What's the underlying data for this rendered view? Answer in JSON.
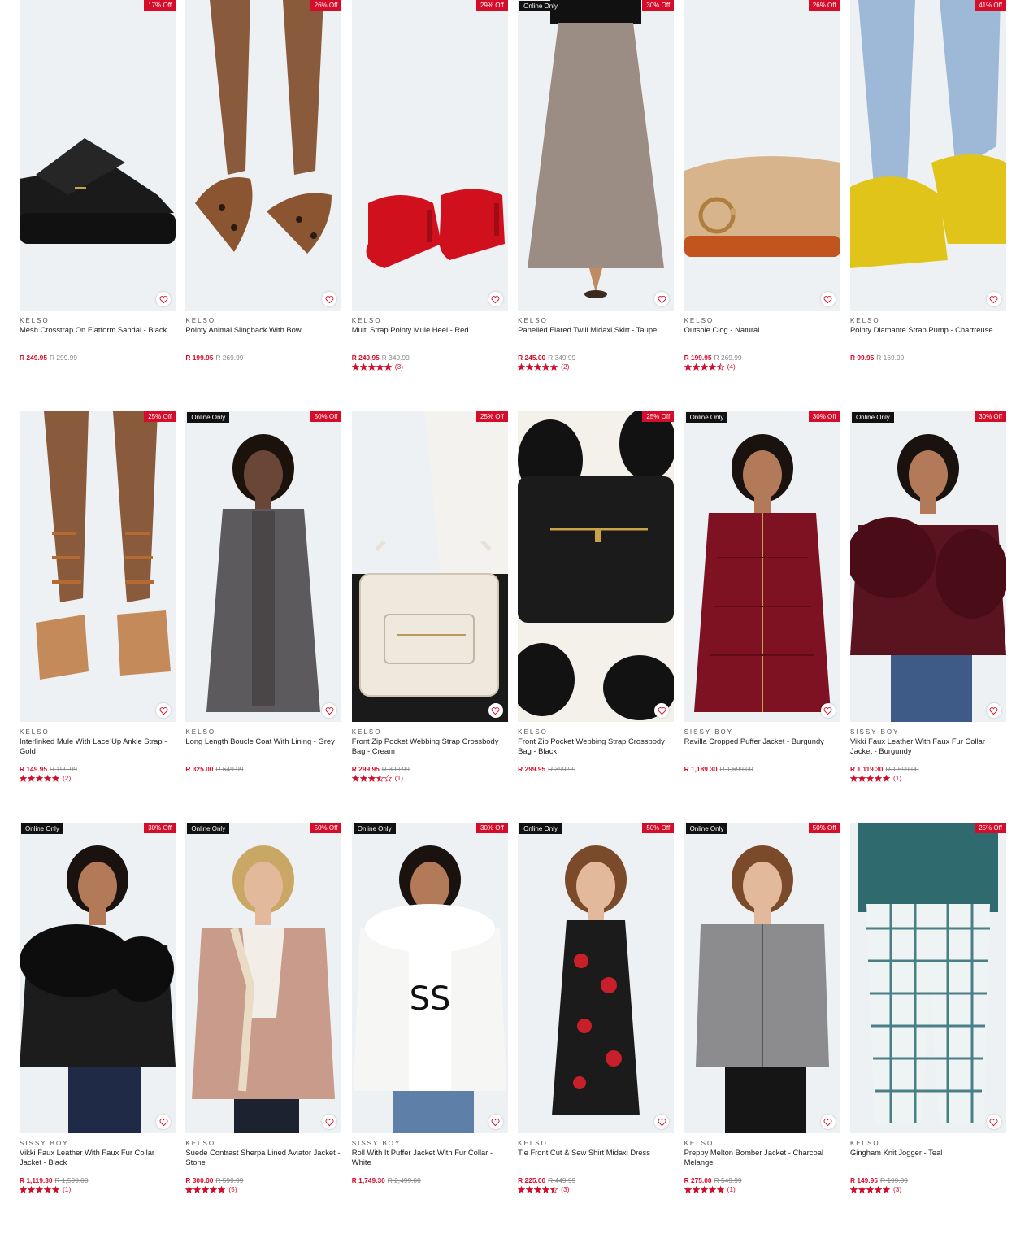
{
  "colors": {
    "sale_red": "#d50d2a",
    "badge_black": "#111111",
    "image_bg": "#edf1f3"
  },
  "products": [
    {
      "brand": "KELSO",
      "name": "Mesh Crosstrap On Flatform Sandal - Black",
      "price": "R 249.95",
      "was": "R 299.99",
      "discount": "17% Off",
      "online": "",
      "rating": null,
      "reviews": "",
      "scene": "sandal-black"
    },
    {
      "brand": "KELSO",
      "name": "Pointy Animal Slingback With Bow",
      "price": "R 199.95",
      "was": "R 269.99",
      "discount": "26% Off",
      "online": "",
      "rating": null,
      "reviews": "",
      "scene": "legs-leopard"
    },
    {
      "brand": "KELSO",
      "name": "Multi Strap Pointy Mule Heel - Red",
      "price": "R 249.95",
      "was": "R 349.99",
      "discount": "29% Off",
      "online": "",
      "rating": 5,
      "reviews": "(3)",
      "scene": "heels-red"
    },
    {
      "brand": "KELSO",
      "name": "Panelled Flared Twill Midaxi Skirt - Taupe",
      "price": "R 245.00",
      "was": "R 349.99",
      "discount": "30% Off",
      "online": "Online Only",
      "rating": 5,
      "reviews": "(2)",
      "scene": "skirt-taupe"
    },
    {
      "brand": "KELSO",
      "name": "Outsole Clog - Natural",
      "price": "R 199.95",
      "was": "R 269.99",
      "discount": "26% Off",
      "online": "",
      "rating": 4.5,
      "reviews": "(4)",
      "scene": "clog"
    },
    {
      "brand": "KELSO",
      "name": "Pointy Diamante Strap Pump - Chartreuse",
      "price": "R 99.95",
      "was": "R 169.99",
      "discount": "41% Off",
      "online": "",
      "rating": null,
      "reviews": "",
      "scene": "pump-yellow"
    },
    {
      "brand": "KELSO",
      "name": "Interlinked Mule With Lace Up Ankle Strap - Gold",
      "price": "R 149.95",
      "was": "R 199.99",
      "discount": "25% Off",
      "online": "",
      "rating": 5,
      "reviews": "(2)",
      "scene": "sandal-gold"
    },
    {
      "brand": "KELSO",
      "name": "Long Length Boucle Coat With Lining - Grey",
      "price": "R 325.00",
      "was": "R 649.99",
      "discount": "50% Off",
      "online": "Online Only",
      "rating": null,
      "reviews": "",
      "scene": "coat-grey"
    },
    {
      "brand": "KELSO",
      "name": "Front Zip Pocket Webbing Strap Crossbody Bag - Cream",
      "price": "R 299.95",
      "was": "R 399.99",
      "discount": "25% Off",
      "online": "",
      "rating": 3.5,
      "reviews": "(1)",
      "scene": "bag-cream"
    },
    {
      "brand": "KELSO",
      "name": "Front Zip Pocket Webbing Strap Crossbody Bag - Black",
      "price": "R 299.95",
      "was": "R 399.99",
      "discount": "25% Off",
      "online": "",
      "rating": null,
      "reviews": "",
      "scene": "bag-black"
    },
    {
      "brand": "SISSY BOY",
      "name": "Ravilla Cropped Puffer Jacket - Burgundy",
      "price": "R 1,189.30",
      "was": "R 1,699.00",
      "discount": "30% Off",
      "online": "Online Only",
      "rating": null,
      "reviews": "",
      "scene": "puffer-burgundy"
    },
    {
      "brand": "SISSY BOY",
      "name": "Vikki Faux Leather With Faux Fur Collar Jacket - Burgundy",
      "price": "R 1,119.30",
      "was": "R 1,599.00",
      "discount": "30% Off",
      "online": "Online Only",
      "rating": 5,
      "reviews": "(1)",
      "scene": "fur-burgundy"
    },
    {
      "brand": "SISSY BOY",
      "name": "Vikki Faux Leather With Faux Fur Collar Jacket - Black",
      "price": "R 1,119.30",
      "was": "R 1,599.00",
      "discount": "30% Off",
      "online": "Online Only",
      "rating": 5,
      "reviews": "(1)",
      "scene": "fur-black"
    },
    {
      "brand": "KELSO",
      "name": "Suede Contrast Sherpa Lined Aviator Jacket - Stone",
      "price": "R 300.00",
      "was": "R 599.99",
      "discount": "50% Off",
      "online": "Online Only",
      "rating": 5,
      "reviews": "(5)",
      "scene": "aviator-stone"
    },
    {
      "brand": "SISSY BOY",
      "name": "Roll With It Puffer Jacket With Fur Collar - White",
      "price": "R 1,749.30",
      "was": "R 2,499.00",
      "discount": "30% Off",
      "online": "Online Only",
      "rating": null,
      "reviews": "",
      "scene": "puffer-white"
    },
    {
      "brand": "KELSO",
      "name": "Tie Front Cut & Sew Shirt Midaxi Dress",
      "price": "R 225.00",
      "was": "R 449.99",
      "discount": "50% Off",
      "online": "Online Only",
      "rating": 4.5,
      "reviews": "(3)",
      "scene": "dress-floral"
    },
    {
      "brand": "KELSO",
      "name": "Preppy Melton Bomber Jacket - Charcoal Melange",
      "price": "R 275.00",
      "was": "R 549.99",
      "discount": "50% Off",
      "online": "Online Only",
      "rating": 5,
      "reviews": "(1)",
      "scene": "bomber-grey"
    },
    {
      "brand": "KELSO",
      "name": "Gingham Knit Jogger - Teal",
      "price": "R 149.95",
      "was": "R 199.99",
      "discount": "25% Off",
      "online": "",
      "rating": 5,
      "reviews": "(3)",
      "scene": "jogger-teal"
    }
  ]
}
